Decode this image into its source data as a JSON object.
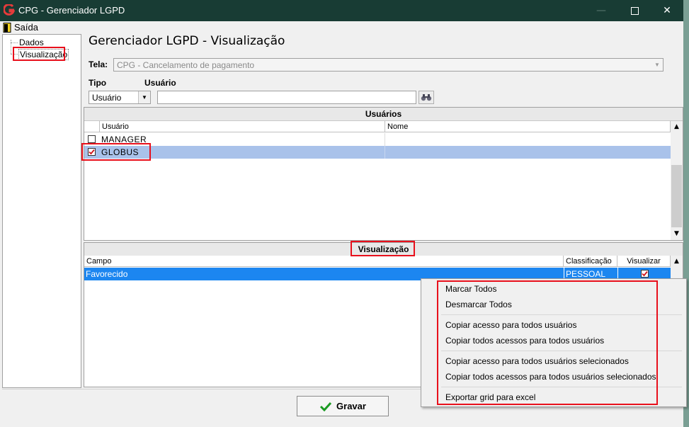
{
  "window": {
    "title": "CPG - Gerenciador LGPD"
  },
  "menu": {
    "exit_label": "Saída"
  },
  "tree": {
    "items": [
      {
        "label": "Dados"
      },
      {
        "label": "Visualização"
      }
    ]
  },
  "main": {
    "heading": "Gerenciador LGPD - Visualização",
    "tela_label": "Tela:",
    "tela_value": "CPG - Cancelamento de pagamento",
    "tipo_label": "Tipo",
    "usuario_label": "Usuário",
    "tipo_value": "Usuário",
    "usuario_value": ""
  },
  "users_panel": {
    "title": "Usuários",
    "columns": [
      "Usuário",
      "Nome"
    ],
    "rows": [
      {
        "usuario": "MANAGER",
        "nome": "",
        "checked": false
      },
      {
        "usuario": "GLOBUS",
        "nome": "",
        "checked": true
      }
    ]
  },
  "view_panel": {
    "title": "Visualização",
    "columns": [
      "Campo",
      "Classificação",
      "Visualizar"
    ],
    "rows": [
      {
        "campo": "Favorecido",
        "classificacao": "PESSOAL",
        "visualizar": true
      }
    ]
  },
  "context_menu": {
    "items": [
      "Marcar Todos",
      "Desmarcar Todos",
      "Copiar acesso para todos usuários",
      "Copiar todos acessos para todos usuários",
      "Copiar acesso para todos usuários selecionados",
      "Copiar todos acessos para todos usuários selecionados",
      "Exportar grid para excel"
    ]
  },
  "footer": {
    "save_label": "Gravar"
  },
  "colors": {
    "titlebar": "#183c34",
    "selection": "#a9c2ea",
    "highlight_row": "#1c86f0",
    "annotation": "#e8101c",
    "check_red": "#d0141a"
  }
}
